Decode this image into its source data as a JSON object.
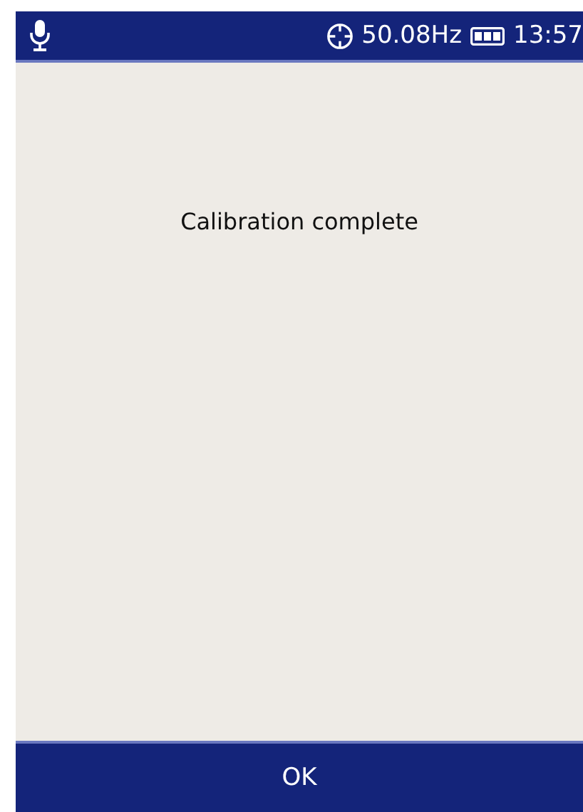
{
  "status_bar": {
    "frequency": "50.08Hz",
    "time": "13:57"
  },
  "message": "Calibration complete",
  "buttons": [
    "OK"
  ]
}
